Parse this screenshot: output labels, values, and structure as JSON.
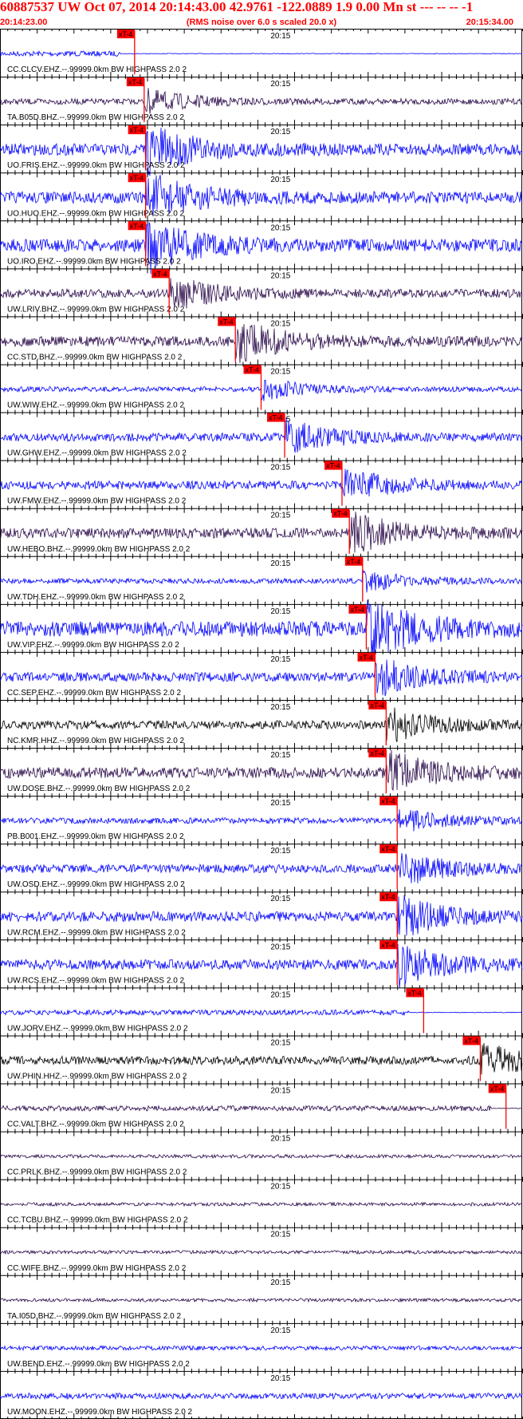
{
  "header": {
    "title": "60887537 UW Oct 07, 2014 20:14:43.00   42.9761 -122.0889  1.9 0.00 Mn st --- -- --   -1",
    "subtitle": "(RMS noise over 6.0 s scaled 20.0 x)",
    "start_time": "20:14:23.00",
    "end_time": "20:15:34.00"
  },
  "chart_data": {
    "type": "line",
    "title": "60887537 UW Oct 07, 2014 20:14:43.00   42.9761 -122.0889  1.9 0.00 Mn st --- -- --   -1",
    "subtitle": "(RMS noise over 6.0 s scaled 20.0 x)",
    "x_axis": {
      "start": "20:14:23.00",
      "end": "20:15:34.00",
      "range_seconds": [
        0,
        71
      ],
      "minute_mark_label": "20:15",
      "minute_mark_seconds": 37
    },
    "pick_label": "xT-4",
    "colors": {
      "blue": "#0000ff",
      "dark": "#2a0a4a",
      "black": "#000000",
      "pick": "#ff0000"
    },
    "traces": [
      {
        "label": "CC.CLCV.EHZ.--.99999.0km BW  HIGHPASS  2.0  2",
        "pick_s": 18.3,
        "color": "blue",
        "amp": 0.12,
        "flat": true
      },
      {
        "label": "TA.B05D.BHZ.--.99999.0km BW  HIGHPASS  2.0  2",
        "pick_s": 19.6,
        "color": "dark",
        "amp": 0.35
      },
      {
        "label": "UO.FRIS.EHZ.--.99999.0km BW  HIGHPASS  2.0  2",
        "pick_s": 19.8,
        "color": "blue",
        "amp": 0.7
      },
      {
        "label": "UO.HUO.EHZ.--.99999.0km BW  HIGHPASS  2.0  2",
        "pick_s": 19.8,
        "color": "blue",
        "amp": 0.7
      },
      {
        "label": "UO.IRO.EHZ.--.99999.0km BW  HIGHPASS  2.0  2",
        "pick_s": 19.8,
        "color": "blue",
        "amp": 0.75
      },
      {
        "label": "UW.LRIV.BHZ.--.99999.0km BW  HIGHPASS  2.0  2",
        "pick_s": 23.0,
        "color": "dark",
        "amp": 0.5
      },
      {
        "label": "CC.STD.BHZ.--.99999.0km BW  HIGHPASS  2.0  2",
        "pick_s": 32.0,
        "color": "dark",
        "amp": 0.6
      },
      {
        "label": "UW.WIW.EHZ.--.99999.0km BW  HIGHPASS  2.0  2",
        "pick_s": 35.5,
        "color": "blue",
        "amp": 0.3
      },
      {
        "label": "UW.GHW.EHZ.--.99999.0km BW  HIGHPASS  2.0  2",
        "pick_s": 38.7,
        "color": "blue",
        "amp": 0.5
      },
      {
        "label": "UW.FMW.EHZ.--.99999.0km BW  HIGHPASS  2.0  2",
        "pick_s": 46.5,
        "color": "blue",
        "amp": 0.5
      },
      {
        "label": "UW.HEBO.BHZ.--.99999.0km BW  HIGHPASS  2.0  2",
        "pick_s": 47.5,
        "color": "dark",
        "amp": 0.6
      },
      {
        "label": "UW.TDH.EHZ.--.99999.0km BW  HIGHPASS  2.0  2",
        "pick_s": 49.3,
        "color": "blue",
        "amp": 0.3
      },
      {
        "label": "UW.VIP.EHZ.--.99999.0km BW  HIGHPASS  2.0  2",
        "pick_s": 49.8,
        "color": "blue",
        "amp": 0.9
      },
      {
        "label": "CC.SEP.EHZ.--.99999.0km BW  HIGHPASS  2.0  2",
        "pick_s": 51.0,
        "color": "blue",
        "amp": 0.55
      },
      {
        "label": "NC.KMR.HHZ.--.99999.0km BW  HIGHPASS  2.0  2",
        "pick_s": 52.5,
        "color": "black",
        "amp": 0.5
      },
      {
        "label": "UW.DOSE.BHZ.--.99999.0km BW  HIGHPASS  2.0  2",
        "pick_s": 52.5,
        "color": "dark",
        "amp": 0.65
      },
      {
        "label": "PB.B001.EHZ.--.99999.0km BW  HIGHPASS  2.0  2",
        "pick_s": 54.0,
        "color": "blue",
        "amp": 0.35
      },
      {
        "label": "UW.OSD.EHZ.--.99999.0km BW  HIGHPASS  2.0  2",
        "pick_s": 54.0,
        "color": "blue",
        "amp": 0.5
      },
      {
        "label": "UW.RCM.EHZ.--.99999.0km BW  HIGHPASS  2.0  2",
        "pick_s": 54.0,
        "color": "blue",
        "amp": 0.6
      },
      {
        "label": "UW.RCS.EHZ.--.99999.0km BW  HIGHPASS  2.0  2",
        "pick_s": 54.0,
        "color": "blue",
        "amp": 0.6
      },
      {
        "label": "UW.JORV.EHZ.--.99999.0km BW  HIGHPASS  2.0  2",
        "pick_s": 57.6,
        "color": "blue",
        "amp": 0.12,
        "flat": true
      },
      {
        "label": "UW.PHIN.HHZ.--.99999.0km BW  HIGHPASS  2.0  2",
        "pick_s": 65.3,
        "color": "black",
        "amp": 0.5
      },
      {
        "label": "CC.VALT.BHZ.--.99999.0km BW  HIGHPASS  2.0  2",
        "pick_s": 68.8,
        "color": "dark",
        "amp": 0.12,
        "flat": true
      },
      {
        "label": "CC.PRLK.BHZ.--.99999.0km BW  HIGHPASS  2.0  2",
        "pick_s": null,
        "color": "dark",
        "amp": 0.2
      },
      {
        "label": "CC.TCBU.BHZ.--.99999.0km BW  HIGHPASS  2.0  2",
        "pick_s": null,
        "color": "dark",
        "amp": 0.2
      },
      {
        "label": "CC.WIFE.BHZ.--.99999.0km BW  HIGHPASS  2.0  2",
        "pick_s": null,
        "color": "dark",
        "amp": 0.2
      },
      {
        "label": "TA.I05D.BHZ.--.99999.0km BW  HIGHPASS  2.0  2",
        "pick_s": null,
        "color": "dark",
        "amp": 0.2
      },
      {
        "label": "UW.BEND.EHZ.--.99999.0km BW  HIGHPASS  2.0  2",
        "pick_s": null,
        "color": "blue",
        "amp": 0.25
      },
      {
        "label": "UW.MOON.EHZ.--.99999.0km BW  HIGHPASS  2.0  2",
        "pick_s": null,
        "color": "blue",
        "amp": 0.35
      }
    ]
  }
}
